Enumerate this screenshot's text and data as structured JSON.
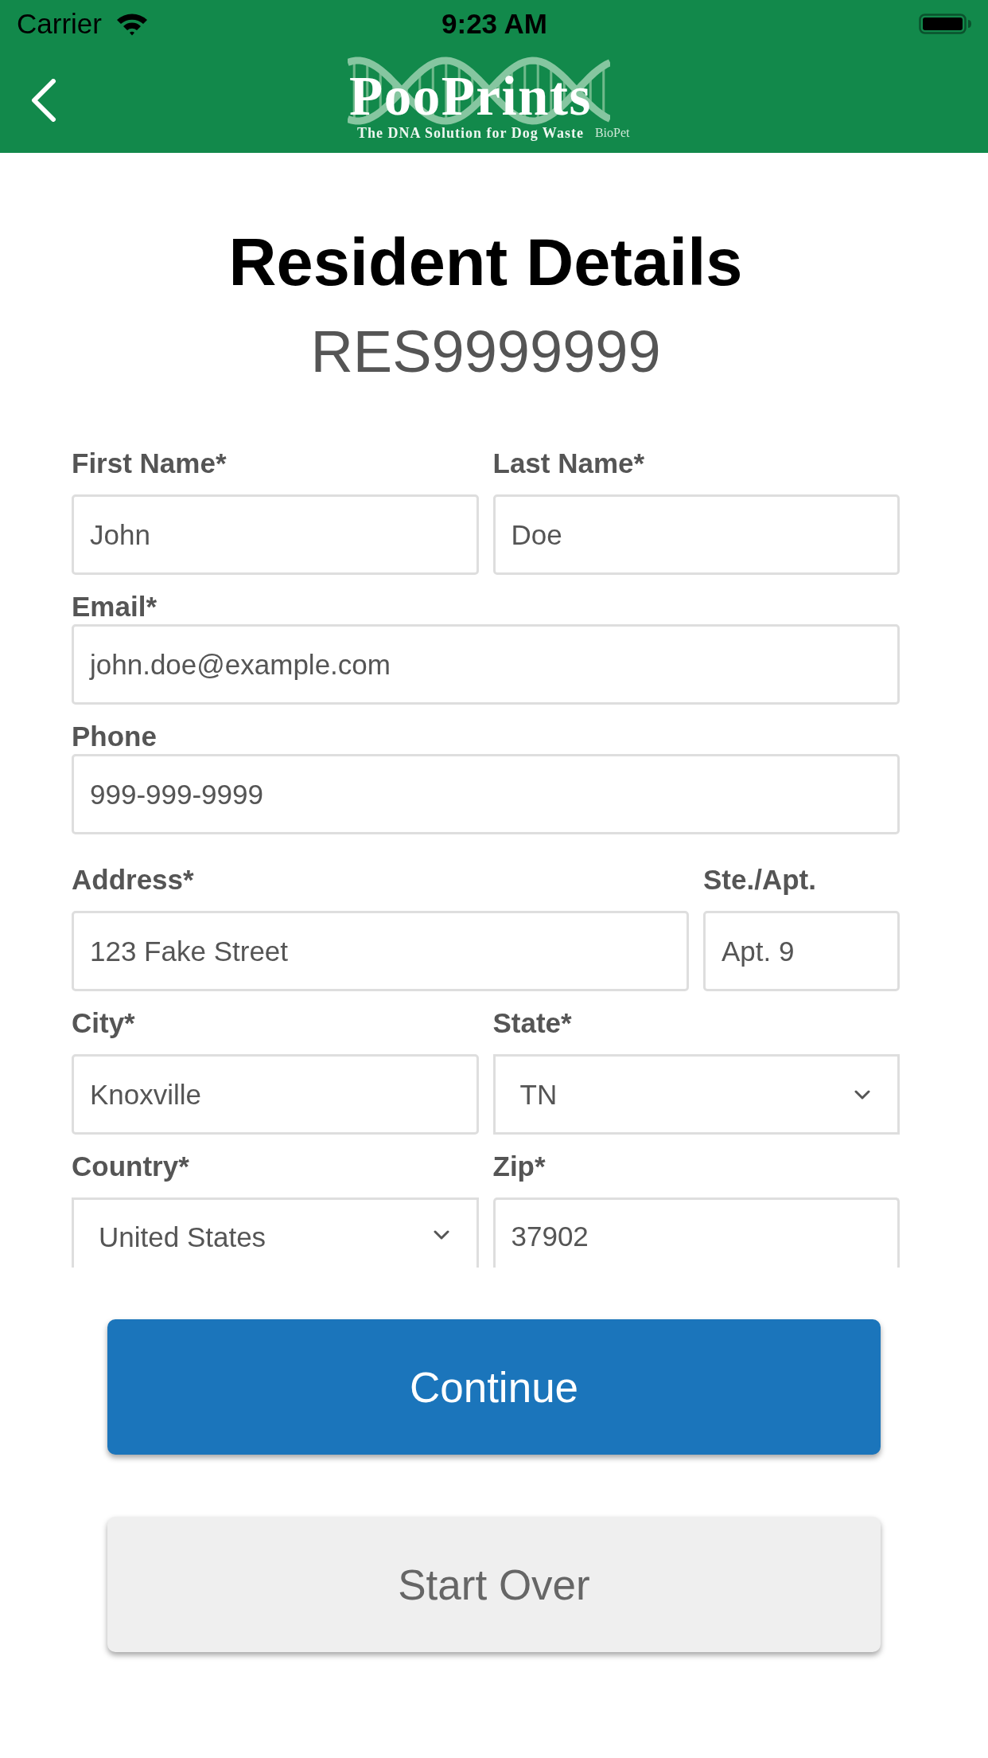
{
  "status_bar": {
    "carrier": "Carrier",
    "time": "9:23 AM"
  },
  "nav_bar": {
    "logo": {
      "wordmark": "PooPrints",
      "tagline": "The DNA Solution for Dog Waste",
      "brand": "BioPet"
    }
  },
  "title": "Resident Details",
  "resident_id": "RES9999999",
  "form": {
    "sections": [
      {
        "rows": [
          {
            "kind": "split",
            "fields": [
              {
                "label": "First Name*",
                "kind": "text",
                "value": "John"
              },
              {
                "label": "Last Name*",
                "kind": "text",
                "value": "Doe"
              }
            ]
          },
          {
            "kind": "full",
            "fields": [
              {
                "label": "Email*",
                "kind": "text",
                "value": "john.doe@example.com"
              }
            ]
          },
          {
            "kind": "full",
            "fields": [
              {
                "label": "Phone",
                "kind": "text",
                "value": "999-999-9999"
              }
            ]
          }
        ]
      },
      {
        "rows": [
          {
            "kind": "main-side",
            "fields": [
              {
                "label": "Address*",
                "kind": "text",
                "value": "123 Fake Street"
              },
              {
                "label": "Ste./Apt.",
                "kind": "text",
                "value": "Apt. 9"
              }
            ]
          },
          {
            "kind": "split",
            "fields": [
              {
                "label": "City*",
                "kind": "text",
                "value": "Knoxville"
              },
              {
                "label": "State*",
                "kind": "select",
                "value": "TN"
              }
            ]
          },
          {
            "kind": "split",
            "fields": [
              {
                "label": "Country*",
                "kind": "select",
                "value": "United States"
              },
              {
                "label": "Zip*",
                "kind": "text",
                "value": "37902"
              }
            ]
          }
        ]
      }
    ]
  },
  "buttons": [
    {
      "label": "Continue",
      "kind": "primary"
    },
    {
      "label": "Start Over",
      "kind": "secondary"
    }
  ]
}
